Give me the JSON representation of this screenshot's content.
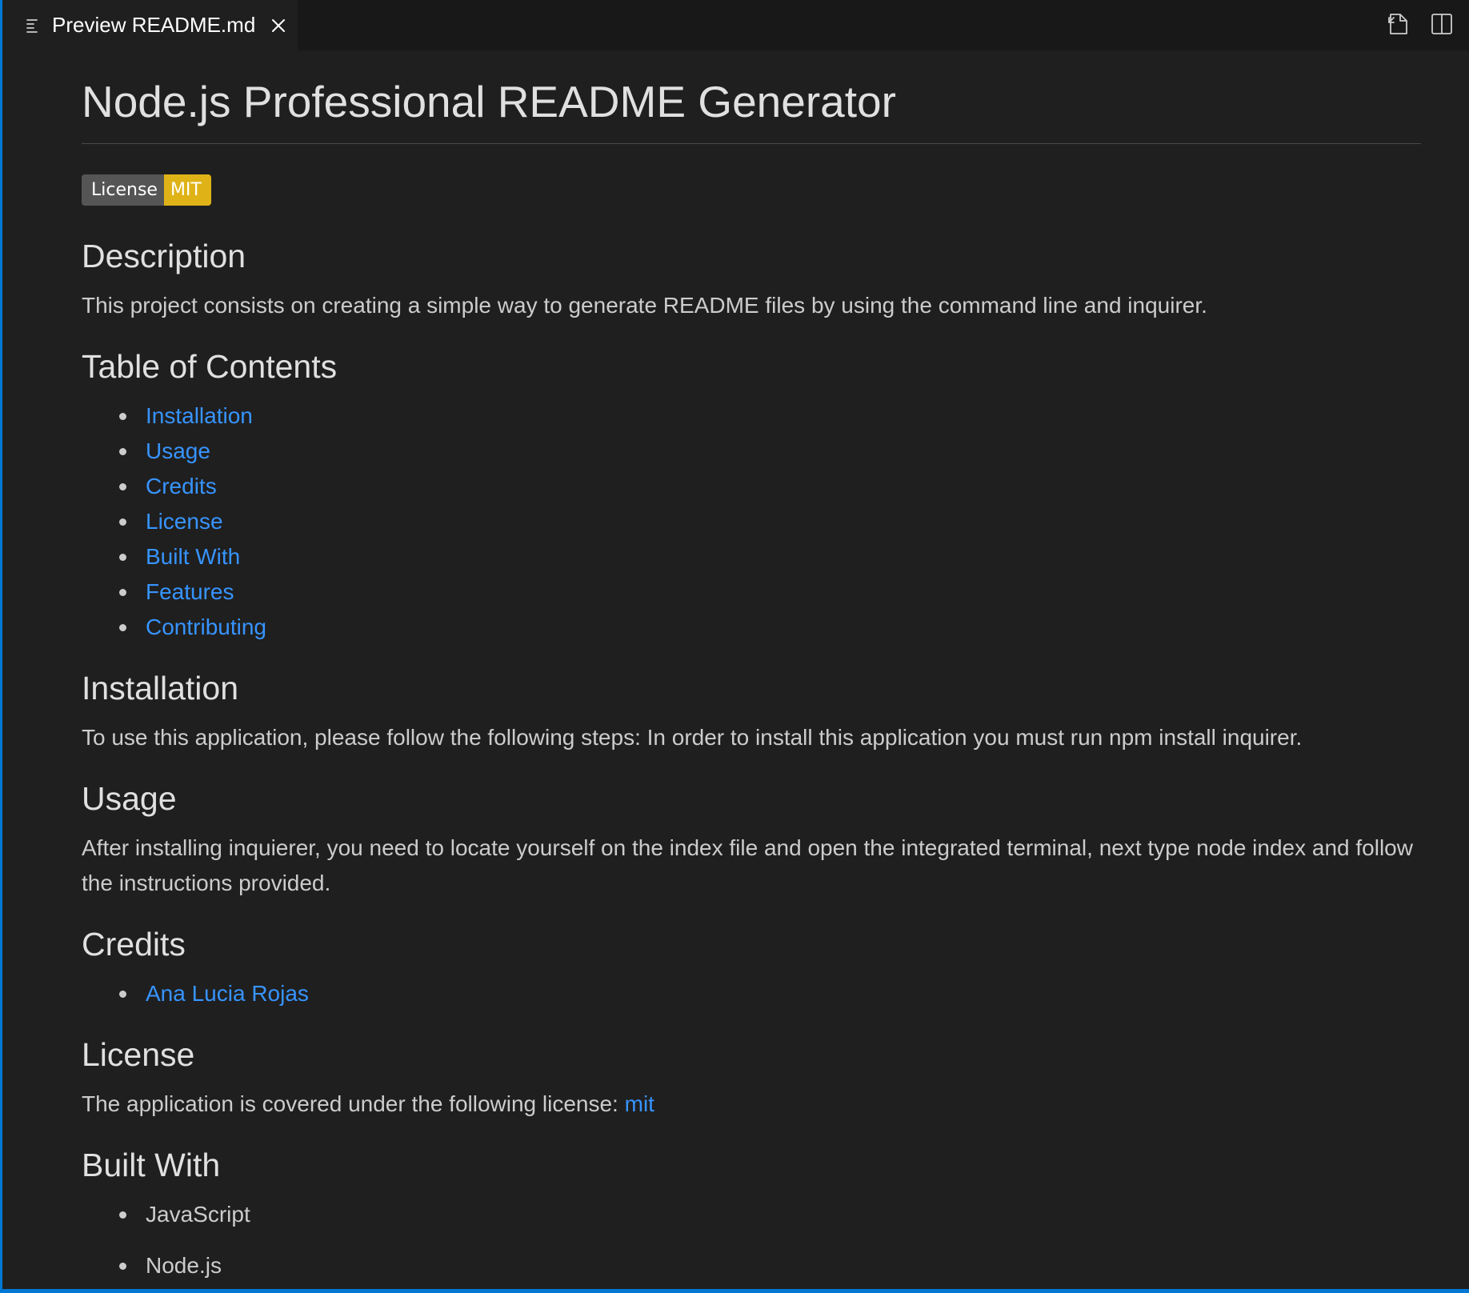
{
  "tab": {
    "title": "Preview README.md",
    "icon": "preview-lines-icon",
    "close_icon": "close-icon"
  },
  "editor_actions": {
    "open_source_icon": "open-source-file-icon",
    "split_editor_icon": "split-editor-icon"
  },
  "doc": {
    "title": "Node.js Professional README Generator",
    "badge": {
      "label": "License",
      "value": "MIT",
      "value_color": "#dfb317"
    },
    "description": {
      "heading": "Description",
      "text": "This project consists on creating a simple way to generate README files by using the command line and inquirer."
    },
    "toc": {
      "heading": "Table of Contents",
      "items": [
        "Installation",
        "Usage",
        "Credits",
        "License",
        "Built With",
        "Features",
        "Contributing"
      ]
    },
    "installation": {
      "heading": "Installation",
      "text": "To use this application, please follow the following steps: In order to install this application you must run npm install inquirer."
    },
    "usage": {
      "heading": "Usage",
      "text": "After installing inquierer, you need to locate yourself on the index file and open the integrated terminal, next type node index and follow the instructions provided."
    },
    "credits": {
      "heading": "Credits",
      "items": [
        "Ana Lucia Rojas"
      ]
    },
    "license": {
      "heading": "License",
      "text": "The application is covered under the following license: ",
      "link": "mit"
    },
    "built_with": {
      "heading": "Built With",
      "items": [
        "JavaScript",
        "Node.js"
      ]
    }
  },
  "colors": {
    "accent": "#0078d4",
    "link": "#3794ff",
    "background": "#1f1f1f"
  }
}
